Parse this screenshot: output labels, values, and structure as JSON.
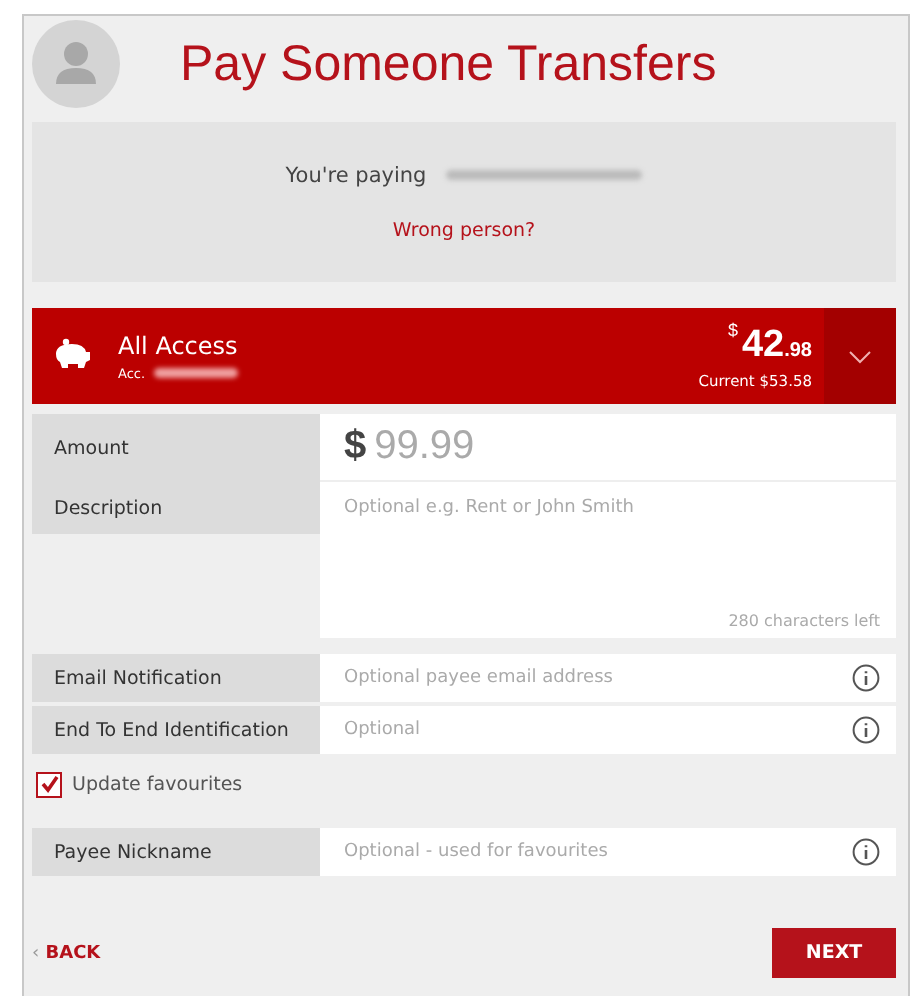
{
  "header": {
    "title": "Pay Someone Transfers"
  },
  "payee": {
    "label": "You're paying",
    "link": "Wrong person?"
  },
  "account": {
    "name": "All Access",
    "number_label": "Acc.",
    "currency": "$",
    "balance_whole": "42",
    "balance_cents": ".98",
    "current": "Current $53.58"
  },
  "fields": [
    {
      "kind": "amount",
      "label": "Amount",
      "currency": "$",
      "placeholder": "99.99"
    },
    {
      "kind": "textarea",
      "label": "Description",
      "placeholder": "Optional e.g. Rent or John Smith",
      "counter": "280 characters left"
    },
    {
      "kind": "text",
      "label": "Email Notification",
      "placeholder": "Optional payee email address",
      "info": true
    },
    {
      "kind": "text",
      "label": "End To End Identification",
      "placeholder": "Optional",
      "info": true
    }
  ],
  "update_favourites": {
    "label": "Update favourites",
    "checked": true
  },
  "nickname": {
    "kind": "text",
    "label": "Payee Nickname",
    "placeholder": "Optional - used for favourites",
    "info": true
  },
  "footer": {
    "back": "BACK",
    "back_icon": "‹",
    "next": "NEXT"
  }
}
